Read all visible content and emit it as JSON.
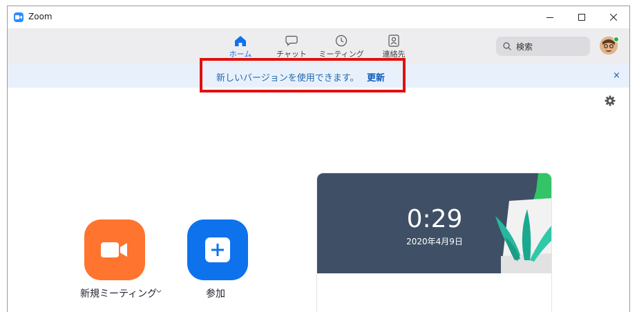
{
  "window": {
    "title": "Zoom"
  },
  "nav": {
    "tabs": [
      {
        "label": "ホーム",
        "icon": "home-icon",
        "active": true
      },
      {
        "label": "チャット",
        "icon": "chat-icon",
        "active": false
      },
      {
        "label": "ミーティング",
        "icon": "clock-icon",
        "active": false
      },
      {
        "label": "連絡先",
        "icon": "contacts-icon",
        "active": false
      }
    ]
  },
  "search": {
    "placeholder": "検索"
  },
  "banner": {
    "message": "新しいバージョンを使用できます。",
    "update_link": "更新",
    "close": "×"
  },
  "actions": {
    "new_meeting": "新規ミーティング",
    "join": "参加"
  },
  "clock": {
    "time": "0:29",
    "date": "2020年4月9日"
  },
  "colors": {
    "accent": "#0e72ed",
    "new_meeting": "#ff742e",
    "banner_bg": "#e8f1fb",
    "highlight": "#e01010",
    "clock_bg": "#3f5066"
  }
}
